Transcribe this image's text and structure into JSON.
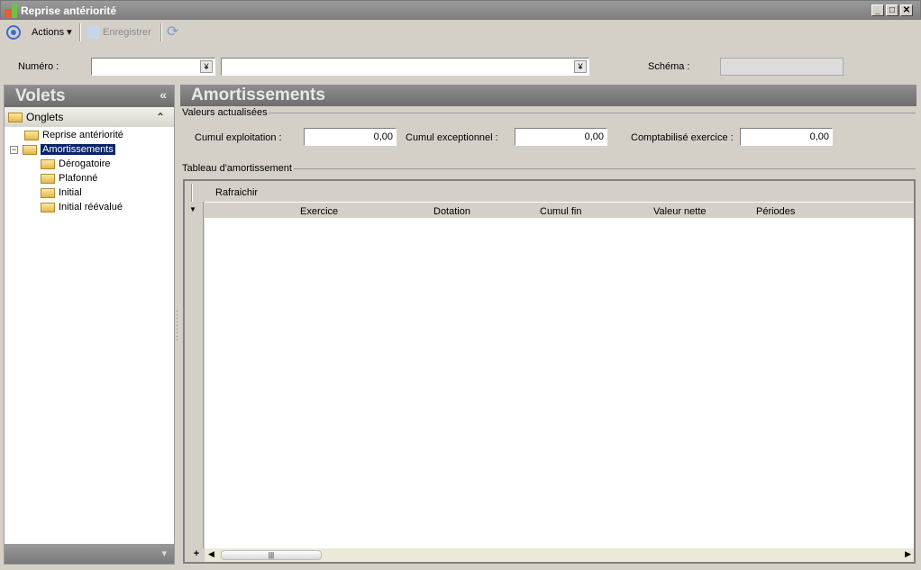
{
  "window": {
    "title": "Reprise antériorité"
  },
  "toolbar": {
    "actions": "Actions",
    "save": "Enregistrer"
  },
  "filters": {
    "numero_label": "Numéro :",
    "numero_value": "",
    "numero2_value": "",
    "schema_label": "Schéma :",
    "schema_value": ""
  },
  "sidebar": {
    "title": "Volets",
    "collapse": "«",
    "section": "Onglets",
    "items": [
      {
        "label": "Reprise antériorité"
      },
      {
        "label": "Amortissements"
      },
      {
        "label": "Dérogatoire"
      },
      {
        "label": "Plafonné"
      },
      {
        "label": "Initial"
      },
      {
        "label": "Initial réévalué"
      }
    ]
  },
  "main": {
    "title": "Amortissements",
    "values_group": "Valeurs actualisées",
    "fields": [
      {
        "label": "Cumul exploitation :",
        "value": "0,00"
      },
      {
        "label": "Cumul exceptionnel :",
        "value": "0,00"
      },
      {
        "label": "Comptabilisé exercice :",
        "value": "0,00"
      }
    ],
    "table_group": "Tableau d'amortissement",
    "refresh": "Rafraichir",
    "columns": [
      "Exercice",
      "Dotation",
      "Cumul fin",
      "Valeur nette",
      "Périodes"
    ],
    "add": "+"
  }
}
